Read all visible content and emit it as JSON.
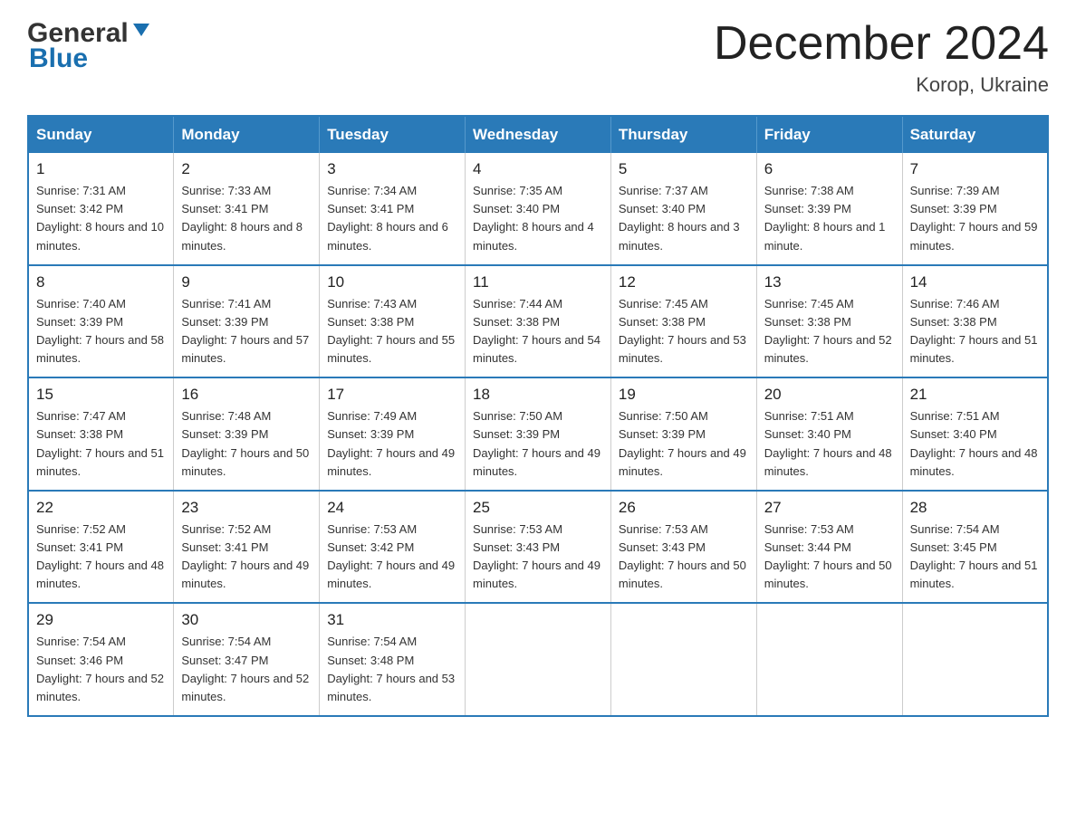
{
  "header": {
    "logo_line1": "General",
    "logo_line2": "Blue",
    "month_title": "December 2024",
    "location": "Korop, Ukraine"
  },
  "weekdays": [
    "Sunday",
    "Monday",
    "Tuesday",
    "Wednesday",
    "Thursday",
    "Friday",
    "Saturday"
  ],
  "weeks": [
    [
      {
        "day": "1",
        "sunrise": "Sunrise: 7:31 AM",
        "sunset": "Sunset: 3:42 PM",
        "daylight": "Daylight: 8 hours and 10 minutes."
      },
      {
        "day": "2",
        "sunrise": "Sunrise: 7:33 AM",
        "sunset": "Sunset: 3:41 PM",
        "daylight": "Daylight: 8 hours and 8 minutes."
      },
      {
        "day": "3",
        "sunrise": "Sunrise: 7:34 AM",
        "sunset": "Sunset: 3:41 PM",
        "daylight": "Daylight: 8 hours and 6 minutes."
      },
      {
        "day": "4",
        "sunrise": "Sunrise: 7:35 AM",
        "sunset": "Sunset: 3:40 PM",
        "daylight": "Daylight: 8 hours and 4 minutes."
      },
      {
        "day": "5",
        "sunrise": "Sunrise: 7:37 AM",
        "sunset": "Sunset: 3:40 PM",
        "daylight": "Daylight: 8 hours and 3 minutes."
      },
      {
        "day": "6",
        "sunrise": "Sunrise: 7:38 AM",
        "sunset": "Sunset: 3:39 PM",
        "daylight": "Daylight: 8 hours and 1 minute."
      },
      {
        "day": "7",
        "sunrise": "Sunrise: 7:39 AM",
        "sunset": "Sunset: 3:39 PM",
        "daylight": "Daylight: 7 hours and 59 minutes."
      }
    ],
    [
      {
        "day": "8",
        "sunrise": "Sunrise: 7:40 AM",
        "sunset": "Sunset: 3:39 PM",
        "daylight": "Daylight: 7 hours and 58 minutes."
      },
      {
        "day": "9",
        "sunrise": "Sunrise: 7:41 AM",
        "sunset": "Sunset: 3:39 PM",
        "daylight": "Daylight: 7 hours and 57 minutes."
      },
      {
        "day": "10",
        "sunrise": "Sunrise: 7:43 AM",
        "sunset": "Sunset: 3:38 PM",
        "daylight": "Daylight: 7 hours and 55 minutes."
      },
      {
        "day": "11",
        "sunrise": "Sunrise: 7:44 AM",
        "sunset": "Sunset: 3:38 PM",
        "daylight": "Daylight: 7 hours and 54 minutes."
      },
      {
        "day": "12",
        "sunrise": "Sunrise: 7:45 AM",
        "sunset": "Sunset: 3:38 PM",
        "daylight": "Daylight: 7 hours and 53 minutes."
      },
      {
        "day": "13",
        "sunrise": "Sunrise: 7:45 AM",
        "sunset": "Sunset: 3:38 PM",
        "daylight": "Daylight: 7 hours and 52 minutes."
      },
      {
        "day": "14",
        "sunrise": "Sunrise: 7:46 AM",
        "sunset": "Sunset: 3:38 PM",
        "daylight": "Daylight: 7 hours and 51 minutes."
      }
    ],
    [
      {
        "day": "15",
        "sunrise": "Sunrise: 7:47 AM",
        "sunset": "Sunset: 3:38 PM",
        "daylight": "Daylight: 7 hours and 51 minutes."
      },
      {
        "day": "16",
        "sunrise": "Sunrise: 7:48 AM",
        "sunset": "Sunset: 3:39 PM",
        "daylight": "Daylight: 7 hours and 50 minutes."
      },
      {
        "day": "17",
        "sunrise": "Sunrise: 7:49 AM",
        "sunset": "Sunset: 3:39 PM",
        "daylight": "Daylight: 7 hours and 49 minutes."
      },
      {
        "day": "18",
        "sunrise": "Sunrise: 7:50 AM",
        "sunset": "Sunset: 3:39 PM",
        "daylight": "Daylight: 7 hours and 49 minutes."
      },
      {
        "day": "19",
        "sunrise": "Sunrise: 7:50 AM",
        "sunset": "Sunset: 3:39 PM",
        "daylight": "Daylight: 7 hours and 49 minutes."
      },
      {
        "day": "20",
        "sunrise": "Sunrise: 7:51 AM",
        "sunset": "Sunset: 3:40 PM",
        "daylight": "Daylight: 7 hours and 48 minutes."
      },
      {
        "day": "21",
        "sunrise": "Sunrise: 7:51 AM",
        "sunset": "Sunset: 3:40 PM",
        "daylight": "Daylight: 7 hours and 48 minutes."
      }
    ],
    [
      {
        "day": "22",
        "sunrise": "Sunrise: 7:52 AM",
        "sunset": "Sunset: 3:41 PM",
        "daylight": "Daylight: 7 hours and 48 minutes."
      },
      {
        "day": "23",
        "sunrise": "Sunrise: 7:52 AM",
        "sunset": "Sunset: 3:41 PM",
        "daylight": "Daylight: 7 hours and 49 minutes."
      },
      {
        "day": "24",
        "sunrise": "Sunrise: 7:53 AM",
        "sunset": "Sunset: 3:42 PM",
        "daylight": "Daylight: 7 hours and 49 minutes."
      },
      {
        "day": "25",
        "sunrise": "Sunrise: 7:53 AM",
        "sunset": "Sunset: 3:43 PM",
        "daylight": "Daylight: 7 hours and 49 minutes."
      },
      {
        "day": "26",
        "sunrise": "Sunrise: 7:53 AM",
        "sunset": "Sunset: 3:43 PM",
        "daylight": "Daylight: 7 hours and 50 minutes."
      },
      {
        "day": "27",
        "sunrise": "Sunrise: 7:53 AM",
        "sunset": "Sunset: 3:44 PM",
        "daylight": "Daylight: 7 hours and 50 minutes."
      },
      {
        "day": "28",
        "sunrise": "Sunrise: 7:54 AM",
        "sunset": "Sunset: 3:45 PM",
        "daylight": "Daylight: 7 hours and 51 minutes."
      }
    ],
    [
      {
        "day": "29",
        "sunrise": "Sunrise: 7:54 AM",
        "sunset": "Sunset: 3:46 PM",
        "daylight": "Daylight: 7 hours and 52 minutes."
      },
      {
        "day": "30",
        "sunrise": "Sunrise: 7:54 AM",
        "sunset": "Sunset: 3:47 PM",
        "daylight": "Daylight: 7 hours and 52 minutes."
      },
      {
        "day": "31",
        "sunrise": "Sunrise: 7:54 AM",
        "sunset": "Sunset: 3:48 PM",
        "daylight": "Daylight: 7 hours and 53 minutes."
      },
      null,
      null,
      null,
      null
    ]
  ]
}
